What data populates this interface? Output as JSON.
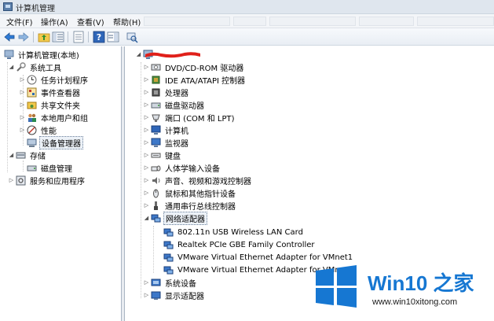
{
  "window": {
    "title": "计算机管理"
  },
  "menu": {
    "file": "文件(F)",
    "action": "操作(A)",
    "view": "查看(V)",
    "help": "帮助(H)"
  },
  "left_tree": {
    "root": "计算机管理(本地)",
    "system_tools": "系统工具",
    "task_scheduler": "任务计划程序",
    "event_viewer": "事件查看器",
    "shared_folders": "共享文件夹",
    "local_users": "本地用户和组",
    "performance": "性能",
    "device_manager": "设备管理器",
    "storage": "存储",
    "disk_management": "磁盘管理",
    "services_apps": "服务和应用程序"
  },
  "devices": {
    "dvd": "DVD/CD-ROM 驱动器",
    "ide": "IDE ATA/ATAPI 控制器",
    "processor": "处理器",
    "disk_drives": "磁盘驱动器",
    "ports": "端口 (COM 和 LPT)",
    "computer": "计算机",
    "monitors": "监视器",
    "keyboard": "键盘",
    "hid": "人体学输入设备",
    "sound": "声音、视频和游戏控制器",
    "mouse": "鼠标和其他指针设备",
    "usb": "通用串行总线控制器",
    "network": "网络适配器",
    "net_children": [
      "802.11n USB Wireless LAN Card",
      "Realtek PCIe GBE Family Controller",
      "VMware Virtual Ethernet Adapter for VMnet1",
      "VMware Virtual Ethernet Adapter for VMnet8"
    ],
    "system_devices": "系统设备",
    "display": "显示适配器"
  },
  "watermark": {
    "title": "Win10 之家",
    "url": "www.win10xitong.com"
  },
  "colors": {
    "accent": "#1677d2",
    "selection": "#edf2f8"
  }
}
